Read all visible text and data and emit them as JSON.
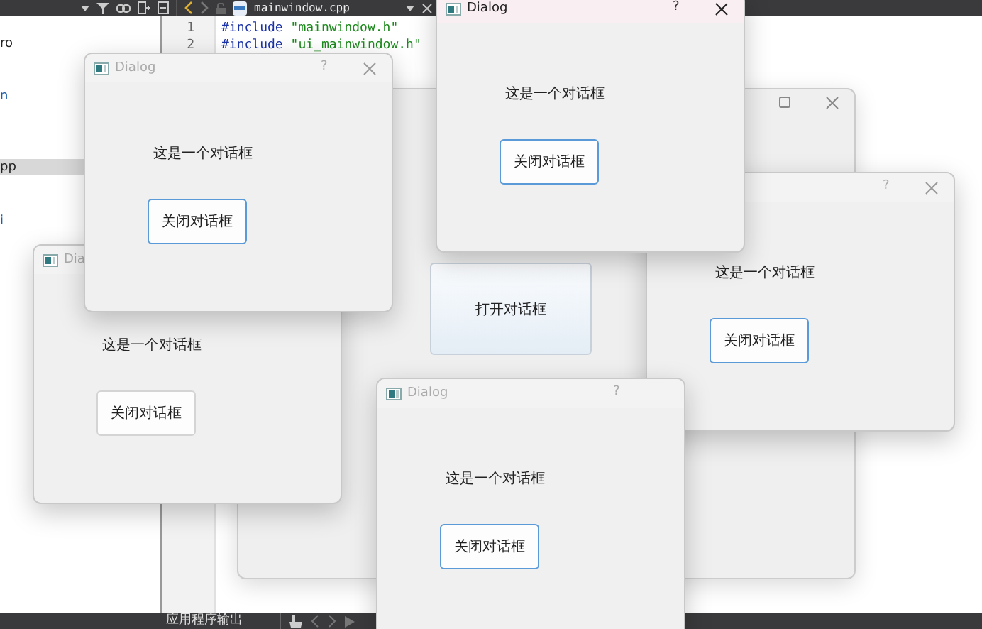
{
  "ide": {
    "file_tab": "mainwindow.cpp",
    "project_tree": [
      {
        "label": "ro",
        "kind": "file",
        "selected": false
      },
      {
        "label": "n",
        "kind": "folder",
        "selected": false
      },
      {
        "label": "pp",
        "kind": "file",
        "selected": true
      },
      {
        "label": "i",
        "kind": "folder",
        "selected": false
      }
    ],
    "editor_lines": [
      {
        "number": "1",
        "directive": "#include",
        "header": "\"mainwindow.h\""
      },
      {
        "number": "2",
        "directive": "#include",
        "header": "\"ui_mainwindow.h\""
      }
    ],
    "output_pane": {
      "title": "应用程序输出"
    }
  },
  "main_window": {
    "button": "打开对话框"
  },
  "dialogs": [
    {
      "title": "Dia",
      "close": false,
      "active": false,
      "message": "这是一个对话框",
      "button": {
        "label": "关闭对话框",
        "focused": false
      }
    },
    {
      "title": "Dialog",
      "help": "?",
      "close": true,
      "active": false,
      "message": "这是一个对话框",
      "button": {
        "label": "关闭对话框",
        "focused": true
      }
    },
    {
      "help": "?",
      "close": true,
      "active": false,
      "message": "这是一个对话框",
      "button": {
        "label": "关闭对话框",
        "focused": true
      }
    },
    {
      "title": "Dialog",
      "help": "?",
      "close": false,
      "active": false,
      "message": "这是一个对话框",
      "button": {
        "label": "关闭对话框",
        "focused": true
      }
    },
    {
      "title": "Dialog",
      "help": "?",
      "close": true,
      "active": true,
      "message": "这是一个对话框",
      "button": {
        "label": "关闭对话框",
        "focused": true
      }
    }
  ]
}
